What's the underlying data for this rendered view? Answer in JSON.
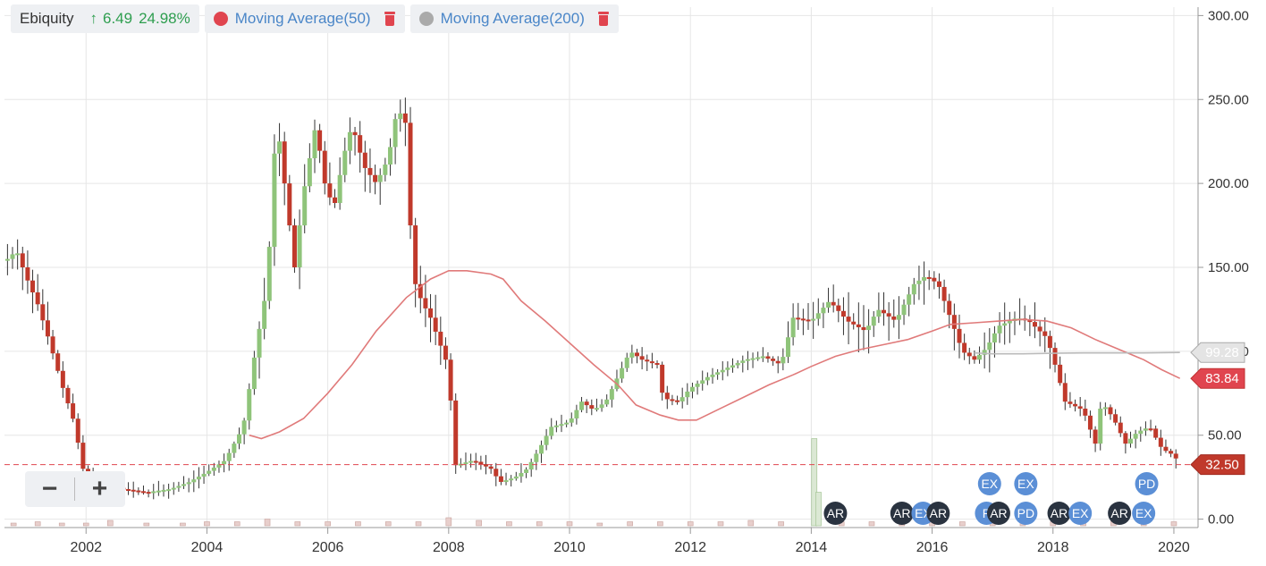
{
  "legend": {
    "ticker": "Ebiquity",
    "change_arrow": "↑",
    "change_value": "6.49",
    "change_pct": "24.98%",
    "ma50_label": "Moving Average(50)",
    "ma200_label": "Moving Average(200)",
    "ma50_color": "#e0454f",
    "ma200_color": "#aaaaaa"
  },
  "zoom": {
    "out_label": "−",
    "in_label": "+"
  },
  "chart_data": {
    "type": "candlestick",
    "xlim": [
      2000.65,
      2020.4
    ],
    "ylim": [
      -5,
      305
    ],
    "y_ticks": [
      "300.00",
      "250.00",
      "200.00",
      "150.00",
      "100.00",
      "50.00",
      "0.00"
    ],
    "y_tick_values": [
      300,
      250,
      200,
      150,
      100,
      50,
      0
    ],
    "x_ticks": [
      "2002",
      "2004",
      "2006",
      "2008",
      "2010",
      "2012",
      "2014",
      "2016",
      "2018",
      "2020"
    ],
    "x_tick_values": [
      2002,
      2004,
      2006,
      2008,
      2010,
      2012,
      2014,
      2016,
      2018,
      2020
    ],
    "up_color": "#8fc47a",
    "down_color": "#c0392b",
    "close_path": [
      [
        2000.7,
        155
      ],
      [
        2000.85,
        160
      ],
      [
        2001.0,
        145
      ],
      [
        2001.2,
        128
      ],
      [
        2001.4,
        105
      ],
      [
        2001.6,
        80
      ],
      [
        2001.8,
        58
      ],
      [
        2001.95,
        30
      ],
      [
        2002.2,
        22
      ],
      [
        2002.6,
        18
      ],
      [
        2003.0,
        16
      ],
      [
        2003.4,
        18
      ],
      [
        2003.7,
        22
      ],
      [
        2004.0,
        28
      ],
      [
        2004.3,
        35
      ],
      [
        2004.6,
        55
      ],
      [
        2004.8,
        100
      ],
      [
        2005.0,
        140
      ],
      [
        2005.15,
        240
      ],
      [
        2005.3,
        195
      ],
      [
        2005.45,
        150
      ],
      [
        2005.6,
        195
      ],
      [
        2005.8,
        235
      ],
      [
        2005.95,
        200
      ],
      [
        2006.1,
        185
      ],
      [
        2006.25,
        215
      ],
      [
        2006.4,
        235
      ],
      [
        2006.6,
        210
      ],
      [
        2006.8,
        200
      ],
      [
        2007.0,
        215
      ],
      [
        2007.15,
        245
      ],
      [
        2007.3,
        235
      ],
      [
        2007.4,
        145
      ],
      [
        2007.55,
        130
      ],
      [
        2007.7,
        120
      ],
      [
        2007.9,
        100
      ],
      [
        2008.0,
        90
      ],
      [
        2008.1,
        32
      ],
      [
        2008.4,
        35
      ],
      [
        2008.7,
        30
      ],
      [
        2008.85,
        22
      ],
      [
        2009.1,
        25
      ],
      [
        2009.3,
        30
      ],
      [
        2009.5,
        42
      ],
      [
        2009.7,
        55
      ],
      [
        2010.0,
        58
      ],
      [
        2010.2,
        70
      ],
      [
        2010.4,
        65
      ],
      [
        2010.6,
        70
      ],
      [
        2010.8,
        85
      ],
      [
        2011.0,
        100
      ],
      [
        2011.2,
        95
      ],
      [
        2011.45,
        92
      ],
      [
        2011.55,
        72
      ],
      [
        2011.8,
        70
      ],
      [
        2012.0,
        78
      ],
      [
        2012.3,
        85
      ],
      [
        2012.6,
        90
      ],
      [
        2012.9,
        95
      ],
      [
        2013.2,
        97
      ],
      [
        2013.5,
        92
      ],
      [
        2013.7,
        120
      ],
      [
        2014.0,
        118
      ],
      [
        2014.3,
        130
      ],
      [
        2014.6,
        118
      ],
      [
        2014.9,
        112
      ],
      [
        2015.1,
        125
      ],
      [
        2015.4,
        118
      ],
      [
        2015.7,
        140
      ],
      [
        2015.9,
        145
      ],
      [
        2016.1,
        140
      ],
      [
        2016.3,
        120
      ],
      [
        2016.5,
        100
      ],
      [
        2016.7,
        95
      ],
      [
        2016.9,
        102
      ],
      [
        2017.1,
        115
      ],
      [
        2017.4,
        120
      ],
      [
        2017.6,
        118
      ],
      [
        2017.9,
        108
      ],
      [
        2018.05,
        90
      ],
      [
        2018.2,
        70
      ],
      [
        2018.5,
        65
      ],
      [
        2018.7,
        45
      ],
      [
        2018.8,
        70
      ],
      [
        2019.0,
        60
      ],
      [
        2019.2,
        45
      ],
      [
        2019.4,
        52
      ],
      [
        2019.6,
        55
      ],
      [
        2019.8,
        42
      ],
      [
        2020.0,
        38
      ],
      [
        2020.1,
        32.5
      ]
    ],
    "ma50": [
      [
        2004.7,
        50
      ],
      [
        2004.9,
        48
      ],
      [
        2005.2,
        52
      ],
      [
        2005.6,
        60
      ],
      [
        2006.0,
        75
      ],
      [
        2006.4,
        92
      ],
      [
        2006.8,
        112
      ],
      [
        2007.3,
        132
      ],
      [
        2007.7,
        143
      ],
      [
        2008.0,
        148
      ],
      [
        2008.3,
        148
      ],
      [
        2008.7,
        146
      ],
      [
        2008.9,
        143
      ],
      [
        2009.2,
        130
      ],
      [
        2009.6,
        118
      ],
      [
        2010.0,
        105
      ],
      [
        2010.4,
        92
      ],
      [
        2010.8,
        80
      ],
      [
        2011.1,
        68
      ],
      [
        2011.5,
        62
      ],
      [
        2011.8,
        59
      ],
      [
        2012.1,
        59
      ],
      [
        2012.5,
        66
      ],
      [
        2012.9,
        73
      ],
      [
        2013.3,
        80
      ],
      [
        2013.7,
        86
      ],
      [
        2014.0,
        91
      ],
      [
        2014.4,
        97
      ],
      [
        2014.8,
        101
      ],
      [
        2015.2,
        104
      ],
      [
        2015.6,
        107
      ],
      [
        2016.0,
        112
      ],
      [
        2016.3,
        116
      ],
      [
        2016.7,
        117
      ],
      [
        2017.1,
        118
      ],
      [
        2017.5,
        119
      ],
      [
        2017.9,
        118
      ],
      [
        2018.3,
        114
      ],
      [
        2018.7,
        107
      ],
      [
        2019.1,
        101
      ],
      [
        2019.5,
        95
      ],
      [
        2019.8,
        89
      ],
      [
        2020.1,
        83.84
      ]
    ],
    "ma200": [
      [
        2016.7,
        99
      ],
      [
        2017.0,
        98.5
      ],
      [
        2017.5,
        98.5
      ],
      [
        2018.0,
        98.8
      ],
      [
        2018.5,
        99
      ],
      [
        2019.0,
        99
      ],
      [
        2019.5,
        99
      ],
      [
        2020.1,
        99.28
      ]
    ],
    "current_price": 32.5,
    "current_price_label": "32.50",
    "ma50_last_label": "83.84",
    "ma200_last_label": "99.28",
    "volume": [
      [
        2000.8,
        0.02
      ],
      [
        2001.2,
        0.03
      ],
      [
        2001.6,
        0.02
      ],
      [
        2002.0,
        0.02
      ],
      [
        2002.4,
        0.04
      ],
      [
        2003.0,
        0.02
      ],
      [
        2003.6,
        0.02
      ],
      [
        2004.0,
        0.03
      ],
      [
        2004.5,
        0.03
      ],
      [
        2005.0,
        0.05
      ],
      [
        2005.5,
        0.03
      ],
      [
        2006.0,
        0.03
      ],
      [
        2006.5,
        0.03
      ],
      [
        2007.0,
        0.03
      ],
      [
        2007.5,
        0.03
      ],
      [
        2008.0,
        0.06
      ],
      [
        2008.5,
        0.04
      ],
      [
        2009.0,
        0.03
      ],
      [
        2009.5,
        0.03
      ],
      [
        2010.0,
        0.03
      ],
      [
        2010.5,
        0.02
      ],
      [
        2011.0,
        0.03
      ],
      [
        2011.5,
        0.03
      ],
      [
        2012.0,
        0.03
      ],
      [
        2012.5,
        0.03
      ],
      [
        2013.0,
        0.04
      ],
      [
        2013.5,
        0.03
      ],
      [
        2014.05,
        0.65
      ],
      [
        2014.12,
        0.25
      ],
      [
        2014.5,
        0.03
      ],
      [
        2015.0,
        0.03
      ],
      [
        2015.5,
        0.03
      ],
      [
        2016.0,
        0.03
      ],
      [
        2016.5,
        0.03
      ],
      [
        2017.0,
        0.03
      ],
      [
        2017.5,
        0.03
      ],
      [
        2018.0,
        0.03
      ],
      [
        2018.5,
        0.03
      ],
      [
        2019.0,
        0.04
      ],
      [
        2019.5,
        0.03
      ],
      [
        2020.0,
        0.03
      ]
    ],
    "events": [
      {
        "label": "AR",
        "x": 2014.4,
        "row": 0,
        "color": "#2a3340"
      },
      {
        "label": "AR",
        "x": 2015.5,
        "row": 0,
        "color": "#2a3340"
      },
      {
        "label": "EX",
        "x": 2015.85,
        "row": 0,
        "color": "#5b8fd6"
      },
      {
        "label": "AR",
        "x": 2016.1,
        "row": 0,
        "color": "#2a3340"
      },
      {
        "label": "EX",
        "x": 2016.95,
        "row": 1,
        "color": "#5b8fd6"
      },
      {
        "label": "P",
        "x": 2016.9,
        "row": 0,
        "color": "#5b8fd6"
      },
      {
        "label": "AR",
        "x": 2017.1,
        "row": 0,
        "color": "#2a3340"
      },
      {
        "label": "EX",
        "x": 2017.55,
        "row": 1,
        "color": "#5b8fd6"
      },
      {
        "label": "PD",
        "x": 2017.55,
        "row": 0,
        "color": "#5b8fd6"
      },
      {
        "label": "AR",
        "x": 2018.1,
        "row": 0,
        "color": "#2a3340"
      },
      {
        "label": "EX",
        "x": 2018.45,
        "row": 0,
        "color": "#5b8fd6"
      },
      {
        "label": "AR",
        "x": 2019.1,
        "row": 0,
        "color": "#2a3340"
      },
      {
        "label": "PD",
        "x": 2019.55,
        "row": 1,
        "color": "#5b8fd6"
      },
      {
        "label": "EX",
        "x": 2019.5,
        "row": 0,
        "color": "#5b8fd6"
      }
    ]
  }
}
